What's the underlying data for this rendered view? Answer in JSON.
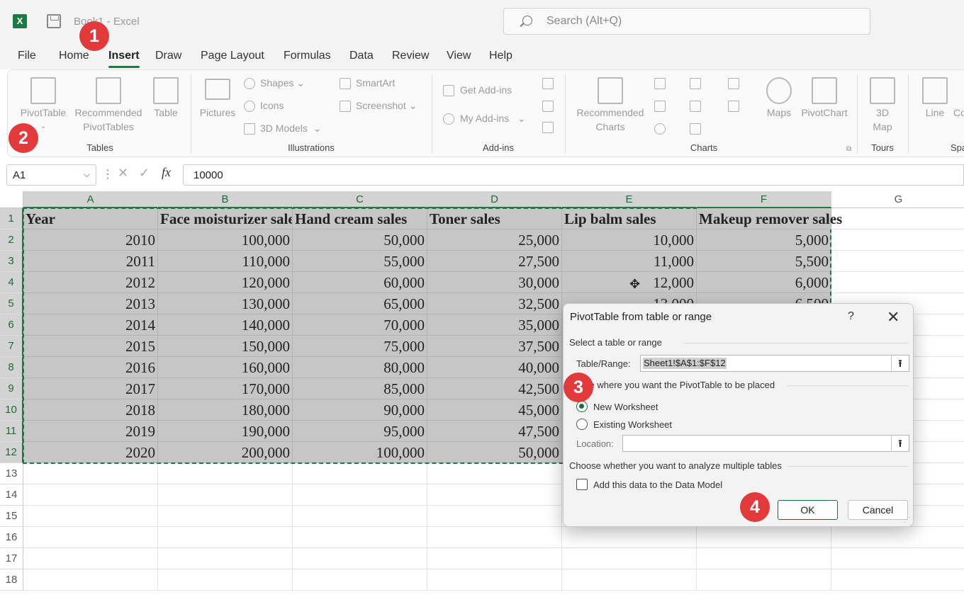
{
  "title_bar": {
    "app_icon_letter": "X",
    "document_title": "Book1  -  Excel",
    "search_placeholder": "Search (Alt+Q)"
  },
  "menu": {
    "tabs": [
      "File",
      "Home",
      "Insert",
      "Draw",
      "Page Layout",
      "Formulas",
      "Data",
      "Review",
      "View",
      "Help"
    ],
    "active": "Insert"
  },
  "ribbon": {
    "tables": {
      "group_label": "Tables",
      "pivot_table": "PivotTable",
      "recommended_pivot_tables": [
        "Recommended",
        "PivotTables"
      ],
      "table": "Table"
    },
    "illustrations": {
      "group_label": "Illustrations",
      "pictures": "Pictures",
      "shapes": "Shapes",
      "icons": "Icons",
      "models_3d": "3D Models",
      "smartart": "SmartArt",
      "screenshot": "Screenshot"
    },
    "addins": {
      "group_label": "Add-ins",
      "get_addins": "Get Add-ins",
      "my_addins": "My Add-ins"
    },
    "charts": {
      "group_label": "Charts",
      "recommended_charts": [
        "Recommended",
        "Charts"
      ],
      "maps": "Maps",
      "pivot_chart": "PivotChart"
    },
    "tours": {
      "group_label": "Tours",
      "map_3d": [
        "3D",
        "Map"
      ]
    },
    "sparklines": {
      "group_label": "Spa",
      "line": "Line",
      "column": "Co"
    }
  },
  "formula_bar": {
    "name_box": "A1",
    "fx": "fx",
    "value": "10000"
  },
  "sheet": {
    "columns": [
      "A",
      "B",
      "C",
      "D",
      "E",
      "F",
      "G"
    ],
    "rows": [
      "1",
      "2",
      "3",
      "4",
      "5",
      "6",
      "7",
      "8",
      "9",
      "10",
      "11",
      "12",
      "13",
      "14",
      "15",
      "16",
      "17",
      "18"
    ],
    "header": [
      "Year",
      "Face moisturizer sales",
      "Hand cream sales",
      "Toner sales",
      "Lip balm sales",
      "Makeup remover sales"
    ],
    "data": [
      [
        "2010",
        "100,000",
        "50,000",
        "25,000",
        "10,000",
        "5,000"
      ],
      [
        "2011",
        "110,000",
        "55,000",
        "27,500",
        "11,000",
        "5,500"
      ],
      [
        "2012",
        "120,000",
        "60,000",
        "30,000",
        "12,000",
        "6,000"
      ],
      [
        "2013",
        "130,000",
        "65,000",
        "32,500",
        "13,000",
        "6,500"
      ],
      [
        "2014",
        "140,000",
        "70,000",
        "35,000",
        "",
        ""
      ],
      [
        "2015",
        "150,000",
        "75,000",
        "37,500",
        "",
        ""
      ],
      [
        "2016",
        "160,000",
        "80,000",
        "40,000",
        "",
        ""
      ],
      [
        "2017",
        "170,000",
        "85,000",
        "42,500",
        "",
        ""
      ],
      [
        "2018",
        "180,000",
        "90,000",
        "45,000",
        "",
        ""
      ],
      [
        "2019",
        "190,000",
        "95,000",
        "47,500",
        "",
        ""
      ],
      [
        "2020",
        "200,000",
        "100,000",
        "50,000",
        "",
        ""
      ]
    ]
  },
  "dialog": {
    "title": "PivotTable from table or range",
    "help": "?",
    "close": "✕",
    "section_select": "Select a table or range",
    "table_range_label": "Table/Range:",
    "table_range_value": "Sheet1!$A$1:$F$12",
    "section_place": "se where you want the PivotTable to be placed",
    "new_worksheet": "New Worksheet",
    "existing_worksheet": "Existing Worksheet",
    "location_label": "Location:",
    "location_value": "",
    "section_multiple": "Choose whether you want to analyze multiple tables",
    "data_model": "Add this data to the Data Model",
    "ok": "OK",
    "cancel": "Cancel",
    "upload_glyph": "⭱"
  },
  "badges": [
    "1",
    "2",
    "3",
    "4"
  ]
}
